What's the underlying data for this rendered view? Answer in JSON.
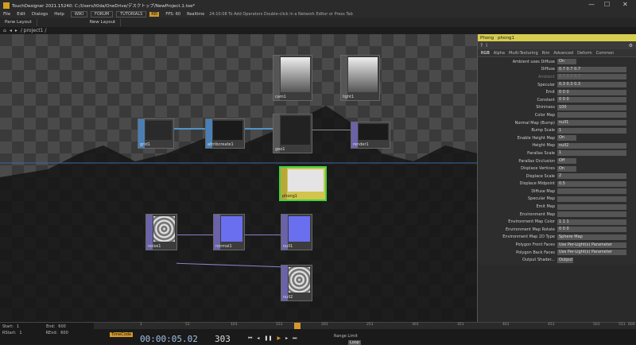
{
  "window": {
    "title": "TouchDesigner 2021.15240: C:/Users/t0da/OneDrive/デスクトップ/NewProject.1.toe*",
    "minimize": "—",
    "maximize": "☐",
    "close": "✕"
  },
  "menu": {
    "items": [
      "File",
      "Edit",
      "Dialogs",
      "Help"
    ],
    "wiki": "WIKI",
    "forum": "FORUM",
    "tutorials": "TUTORIALS",
    "version_badge": "REI",
    "fps": "FPS: 60",
    "realtime": "Realtime",
    "hint": "24:10:08 To Add Operators Double-click in a Network Editor or Press Tab"
  },
  "tabs": {
    "items": [
      "Pane Layout",
      "New Layout"
    ]
  },
  "path": {
    "text": "/ project1 /"
  },
  "nodes": {
    "cam1": "cam1",
    "light1": "light1",
    "grid1": "grid1",
    "attribcreate1": "attribcreate1",
    "geo1": "geo1",
    "render1": "render1",
    "phong1": "phong1",
    "noise1": "noise1",
    "normal1": "normal1",
    "null1": "null1",
    "null2": "null2"
  },
  "panel": {
    "type": "Phong",
    "name": "phong1",
    "tabs": [
      "RGB",
      "Alpha",
      "Multi-Texturing",
      "Rim",
      "Advanced",
      "Deform",
      "Common"
    ],
    "params": [
      {
        "label": "Ambient uses Diffuse",
        "value": "On"
      },
      {
        "label": "Diffuse",
        "value": "0.7   0.7   0.7"
      },
      {
        "label": "Ambient",
        "value": "0.7   0.7   0.7"
      },
      {
        "label": "Specular",
        "value": "0.3   0.3   0.3"
      },
      {
        "label": "Emit",
        "value": "0   0   0"
      },
      {
        "label": "Constant",
        "value": "0   0   0"
      },
      {
        "label": "Shininess",
        "value": "100"
      },
      {
        "label": "Color Map",
        "value": ""
      },
      {
        "label": "Normal Map (Bump)",
        "value": "null1"
      },
      {
        "label": "Bump Scale",
        "value": "1"
      },
      {
        "label": "Enable Height Map",
        "value": "On"
      },
      {
        "label": "Height Map",
        "value": "null2"
      },
      {
        "label": "Parallax Scale",
        "value": "1"
      },
      {
        "label": "Parallax Occlusion",
        "value": "Off"
      },
      {
        "label": "Displace Vertices",
        "value": "On"
      },
      {
        "label": "Displace Scale",
        "value": "2"
      },
      {
        "label": "Displace Midpoint",
        "value": "0.5"
      },
      {
        "label": "Diffuse Map",
        "value": ""
      },
      {
        "label": "Specular Map",
        "value": ""
      },
      {
        "label": "Emit Map",
        "value": ""
      },
      {
        "label": "Environment Map",
        "value": ""
      },
      {
        "label": "Environment Map Color",
        "value": "1   1   1"
      },
      {
        "label": "Environment Map Rotate",
        "value": "0   0   0"
      },
      {
        "label": "Environment Map 2D Type",
        "value": "Sphere Map"
      },
      {
        "label": "Polygon Front Faces",
        "value": "Use Per-Light(s) Parameter"
      },
      {
        "label": "Polygon Back Faces",
        "value": "Use Per-Light(s) Parameter"
      },
      {
        "label": "Output Shader...",
        "value": "Output"
      }
    ]
  },
  "timeline": {
    "start_label": "Start:",
    "start_val": "1",
    "end_label": "End:",
    "end_val": "600",
    "rstart_label": "RStart:",
    "rstart_val": "1",
    "rend_label": "REnd:",
    "rend_val": "600",
    "timecode_label": "TimeCode",
    "timecode": "00:00:05.02",
    "frame": "303",
    "range_limit": "Range Limit",
    "loop": "Loop",
    "ticks": [
      "1",
      "51",
      "101",
      "151",
      "201",
      "251",
      "301",
      "351",
      "401",
      "451",
      "501",
      "551",
      "600"
    ]
  }
}
